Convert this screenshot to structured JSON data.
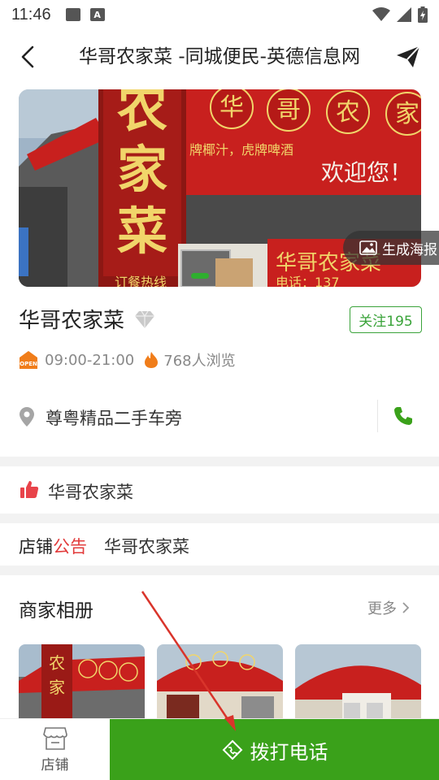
{
  "status_bar": {
    "time": "11:46",
    "a_badge": "A"
  },
  "header": {
    "title": "华哥农家菜 -同城便民-英德信息网"
  },
  "banner": {
    "sign_vertical_chars": [
      "农",
      "家",
      "菜"
    ],
    "sign_top_chars": [
      "华",
      "哥",
      "农",
      "家"
    ],
    "sign_slogan": "牌椰汁，虎牌啤酒",
    "sign_welcome": "欢迎您！",
    "sign_bottom": "华哥农家菜",
    "sign_phone": "电话：137",
    "sign_order": "订餐热线",
    "poster_label": "生成海报"
  },
  "shop": {
    "name": "华哥农家菜",
    "follow_label": "关注195",
    "hours": "09:00-21:00",
    "views": "768人浏览",
    "address": "尊粤精品二手车旁",
    "open_badge": "OPEN"
  },
  "like": {
    "text": "华哥农家菜"
  },
  "notice": {
    "label_a": "店铺",
    "label_b": "公告",
    "text": "华哥农家菜"
  },
  "album": {
    "title": "商家相册",
    "more": "更多"
  },
  "bottom": {
    "store_label": "店铺",
    "call_label": "拨打电话"
  },
  "colors": {
    "brand_green": "#3aa11a",
    "sign_red": "#c8201e",
    "accent_red": "#e23b3b",
    "open_orange": "#f07d1a"
  },
  "icons": [
    "back-icon",
    "share-icon",
    "image-icon",
    "diamond-icon",
    "open-icon",
    "fire-icon",
    "pin-icon",
    "phone-icon",
    "thumbs-up-icon",
    "chevron-right-icon",
    "store-icon",
    "call-icon"
  ]
}
